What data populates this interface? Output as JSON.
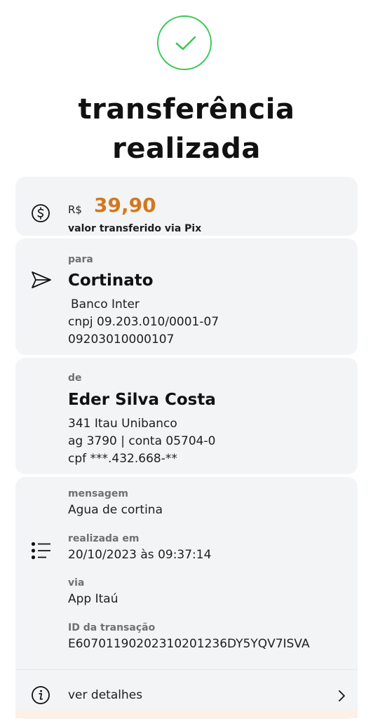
{
  "status": {
    "title_line1": "transferência",
    "title_line2": "realizada"
  },
  "amount": {
    "currency": "R$",
    "value": "39,90",
    "label": "valor transferido via Pix"
  },
  "recipient": {
    "label": "para",
    "name": "Cortinato",
    "bank": "Banco Inter",
    "cnpj": "cnpj 09.203.010/0001-07",
    "account": "09203010000107"
  },
  "sender": {
    "label": "de",
    "name": "Eder Silva Costa",
    "bank": "341 Itau Unibanco",
    "account": "ag 3790 | conta 05704-0",
    "cpf": "cpf ***.432.668-**"
  },
  "info": {
    "message_label": "mensagem",
    "message_value": "Agua de cortina",
    "date_label": "realizada em",
    "date_value": "20/10/2023 às 09:37:14",
    "via_label": "via",
    "via_value": "App Itaú",
    "id_label": "ID da transação",
    "id_value": "E60701190202310201236DY5YQV7ISVA"
  },
  "details": {
    "label": "ver detalhes"
  },
  "icons": {
    "success": "check-icon",
    "amount": "dollar-circle-icon",
    "recipient": "send-icon",
    "info": "list-icon",
    "details": "info-icon",
    "chevron": "chevron-right-icon"
  },
  "colors": {
    "success": "#3cc85a",
    "amount": "#d2781e",
    "card_background": "#f3f4f6"
  }
}
